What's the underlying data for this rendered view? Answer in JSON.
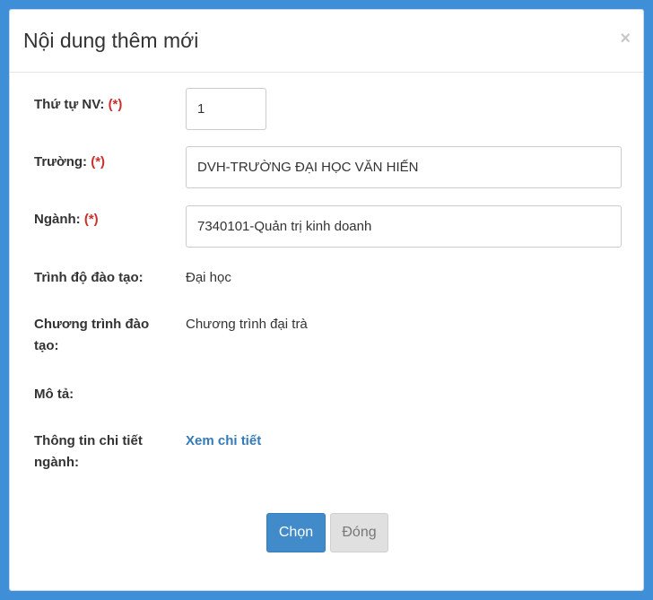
{
  "modal": {
    "title": "Nội dung thêm mới",
    "close_symbol": "×"
  },
  "form": {
    "order": {
      "label": "Thứ tự NV:",
      "required": "(*)",
      "value": "1"
    },
    "school": {
      "label": "Trường:",
      "required": "(*)",
      "value": "DVH-TRƯỜNG ĐẠI HỌC VĂN HIẾN"
    },
    "major": {
      "label": "Ngành:",
      "required": "(*)",
      "value": "7340101-Quản trị kinh doanh"
    },
    "level": {
      "label": "Trình độ đào tạo:",
      "value": "Đại học"
    },
    "program": {
      "label": "Chương trình đào tạo:",
      "value": "Chương trình đại trà"
    },
    "description": {
      "label": "Mô tả:",
      "value": ""
    },
    "details": {
      "label": "Thông tin chi tiết ngành:",
      "link": "Xem chi tiết"
    }
  },
  "footer": {
    "select_label": "Chọn",
    "close_label": "Đóng"
  },
  "colors": {
    "background": "#3f8fd8",
    "required": "#c9302c",
    "link": "#337ab7",
    "primary_button": "#428bca",
    "default_button": "#e0e0e0"
  },
  "icons": {
    "close": "close-icon"
  }
}
